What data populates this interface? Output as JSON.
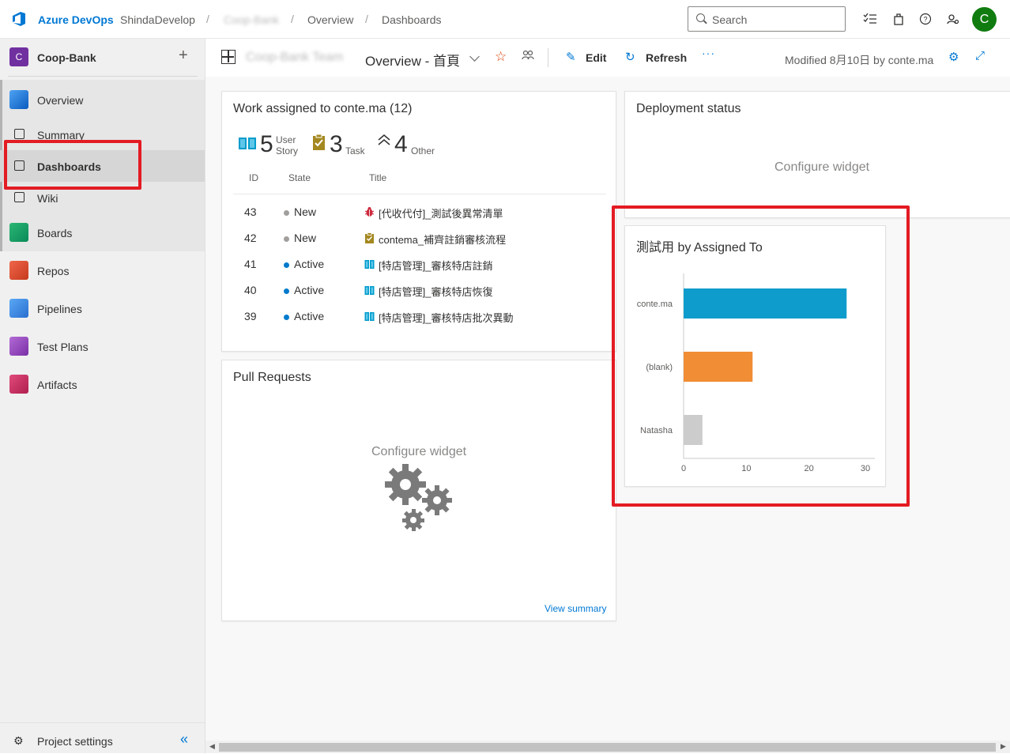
{
  "header": {
    "brand": "Azure DevOps",
    "org": "ShindaDevelop",
    "project_crumb": "Coop-Bank",
    "crumb_overview": "Overview",
    "crumb_dashboards": "Dashboards",
    "search_placeholder": "Search",
    "avatar_initial": "C"
  },
  "sidebar": {
    "project_initial": "C",
    "project_name": "Coop-Bank",
    "items": [
      {
        "label": "Overview"
      },
      {
        "label": "Summary"
      },
      {
        "label": "Dashboards"
      },
      {
        "label": "Wiki"
      },
      {
        "label": "Boards"
      },
      {
        "label": "Repos"
      },
      {
        "label": "Pipelines"
      },
      {
        "label": "Test Plans"
      },
      {
        "label": "Artifacts"
      }
    ],
    "settings_label": "Project settings"
  },
  "toolbar": {
    "team_name": "Coop-Bank Team",
    "dashboard_title": "Overview - 首頁",
    "edit_label": "Edit",
    "refresh_label": "Refresh",
    "more": "···",
    "modified": "Modified 8月10日 by conte.ma"
  },
  "work_widget": {
    "title": "Work assigned to conte.ma (12)",
    "counts": [
      {
        "num": "5",
        "label1": "User",
        "label2": "Story"
      },
      {
        "num": "3",
        "label1": "Task",
        "label2": ""
      },
      {
        "num": "4",
        "label1": "Other",
        "label2": ""
      }
    ],
    "columns": [
      "ID",
      "State",
      "Title"
    ],
    "rows": [
      {
        "id": "43",
        "state": "New",
        "state_color": "#a19f9d",
        "type": "bug",
        "title": "[代收代付]_測試後異常清單"
      },
      {
        "id": "42",
        "state": "New",
        "state_color": "#a19f9d",
        "type": "task",
        "title": "contema_補齊註銷審核流程"
      },
      {
        "id": "41",
        "state": "Active",
        "state_color": "#007acc",
        "type": "story",
        "title": "[特店管理]_審核特店註銷"
      },
      {
        "id": "40",
        "state": "Active",
        "state_color": "#007acc",
        "type": "story",
        "title": "[特店管理]_審核特店恢復"
      },
      {
        "id": "39",
        "state": "Active",
        "state_color": "#007acc",
        "type": "story",
        "title": "[特店管理]_審核特店批次異動"
      }
    ]
  },
  "deployment_widget": {
    "title": "Deployment status",
    "configure": "Configure widget"
  },
  "pr_widget": {
    "title": "Pull Requests",
    "configure": "Configure widget",
    "view_summary": "View summary"
  },
  "chart_data": {
    "type": "bar",
    "orientation": "horizontal",
    "title": "測試用 by Assigned To",
    "categories": [
      "conte.ma",
      "(blank)",
      "Natasha"
    ],
    "values": [
      26,
      11,
      3
    ],
    "colors": [
      "#0e9ccd",
      "#f18d34",
      "#cccccc"
    ],
    "xticks": [
      0,
      10,
      20,
      30
    ],
    "xlim": [
      0,
      30
    ],
    "grid": false
  },
  "colors": {
    "accent": "#0078d4",
    "highlight": "#e31b23"
  }
}
